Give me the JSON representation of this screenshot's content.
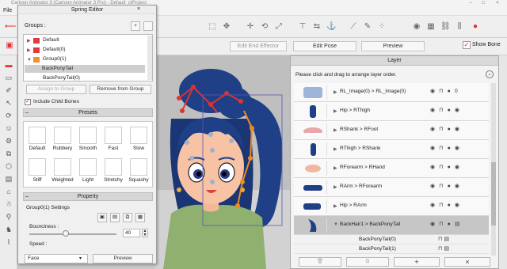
{
  "window": {
    "title": "Cartoon Animator 3 (Cartoon Animator 3 Pro) - Default_ctProject"
  },
  "menu": {
    "file": "File"
  },
  "toolbar2": {
    "edit_end_effector": "Edit End Effector",
    "edit_pose": "Edit Pose",
    "preview": "Preview",
    "show_bone": "Show Bone"
  },
  "spring_editor": {
    "title": "Spring Editor",
    "groups_label": "Groups :",
    "add_label": "+",
    "groups": [
      {
        "label": "Default",
        "color": "#e03a3a",
        "level": 0
      },
      {
        "label": "Default(0)",
        "color": "#e03a3a",
        "level": 0
      },
      {
        "label": "Group0(1)",
        "color": "#f0902a",
        "level": 0
      },
      {
        "label": "BackPonyTail",
        "color": "",
        "level": 1,
        "selected": true
      },
      {
        "label": "BackPonyTail(0)",
        "color": "",
        "level": 1
      }
    ],
    "assign_to_group": "Assign to Group",
    "remove_from_group": "Remove from Group",
    "include_child_bones": "Include Child Bones",
    "presets_header": "Presets",
    "presets_row1": [
      "Default",
      "Rubbery",
      "Smooth",
      "Fast",
      "Slow"
    ],
    "presets_row2": [
      "Stiff",
      "Weighted",
      "Light",
      "Stretchy",
      "Squashy"
    ],
    "property_header": "Property",
    "settings_label": "Group0(1) Settings",
    "bounciness_label": "Bounciness :",
    "bounciness_value": "40",
    "speed_label": "Speed :",
    "face_select": "Face",
    "preview": "Preview"
  },
  "layer_panel": {
    "title": "Layer",
    "hint": "Please click and drag to arrange layer order.",
    "rows": [
      {
        "name": "RL_Image(0) > RL_Image(0)",
        "value": "0"
      },
      {
        "name": "Hip > RThigh",
        "value": ""
      },
      {
        "name": "RShank > RFoot",
        "value": ""
      },
      {
        "name": "RThigh > RShank",
        "value": ""
      },
      {
        "name": "RForearm > RHand",
        "value": ""
      },
      {
        "name": "RArm > RForearm",
        "value": ""
      },
      {
        "name": "Hip > RArm",
        "value": ""
      },
      {
        "name": "BackHair1 > BackPonyTail",
        "value": "",
        "selected": true
      }
    ],
    "sub_rows": [
      "BackPonyTail(0)",
      "BackPonyTail(1)"
    ],
    "bottom_buttons": [
      "+",
      "×"
    ]
  },
  "icons": {
    "eye": "eye-icon",
    "lock": "lock-icon",
    "check": "checkbox-icon"
  }
}
